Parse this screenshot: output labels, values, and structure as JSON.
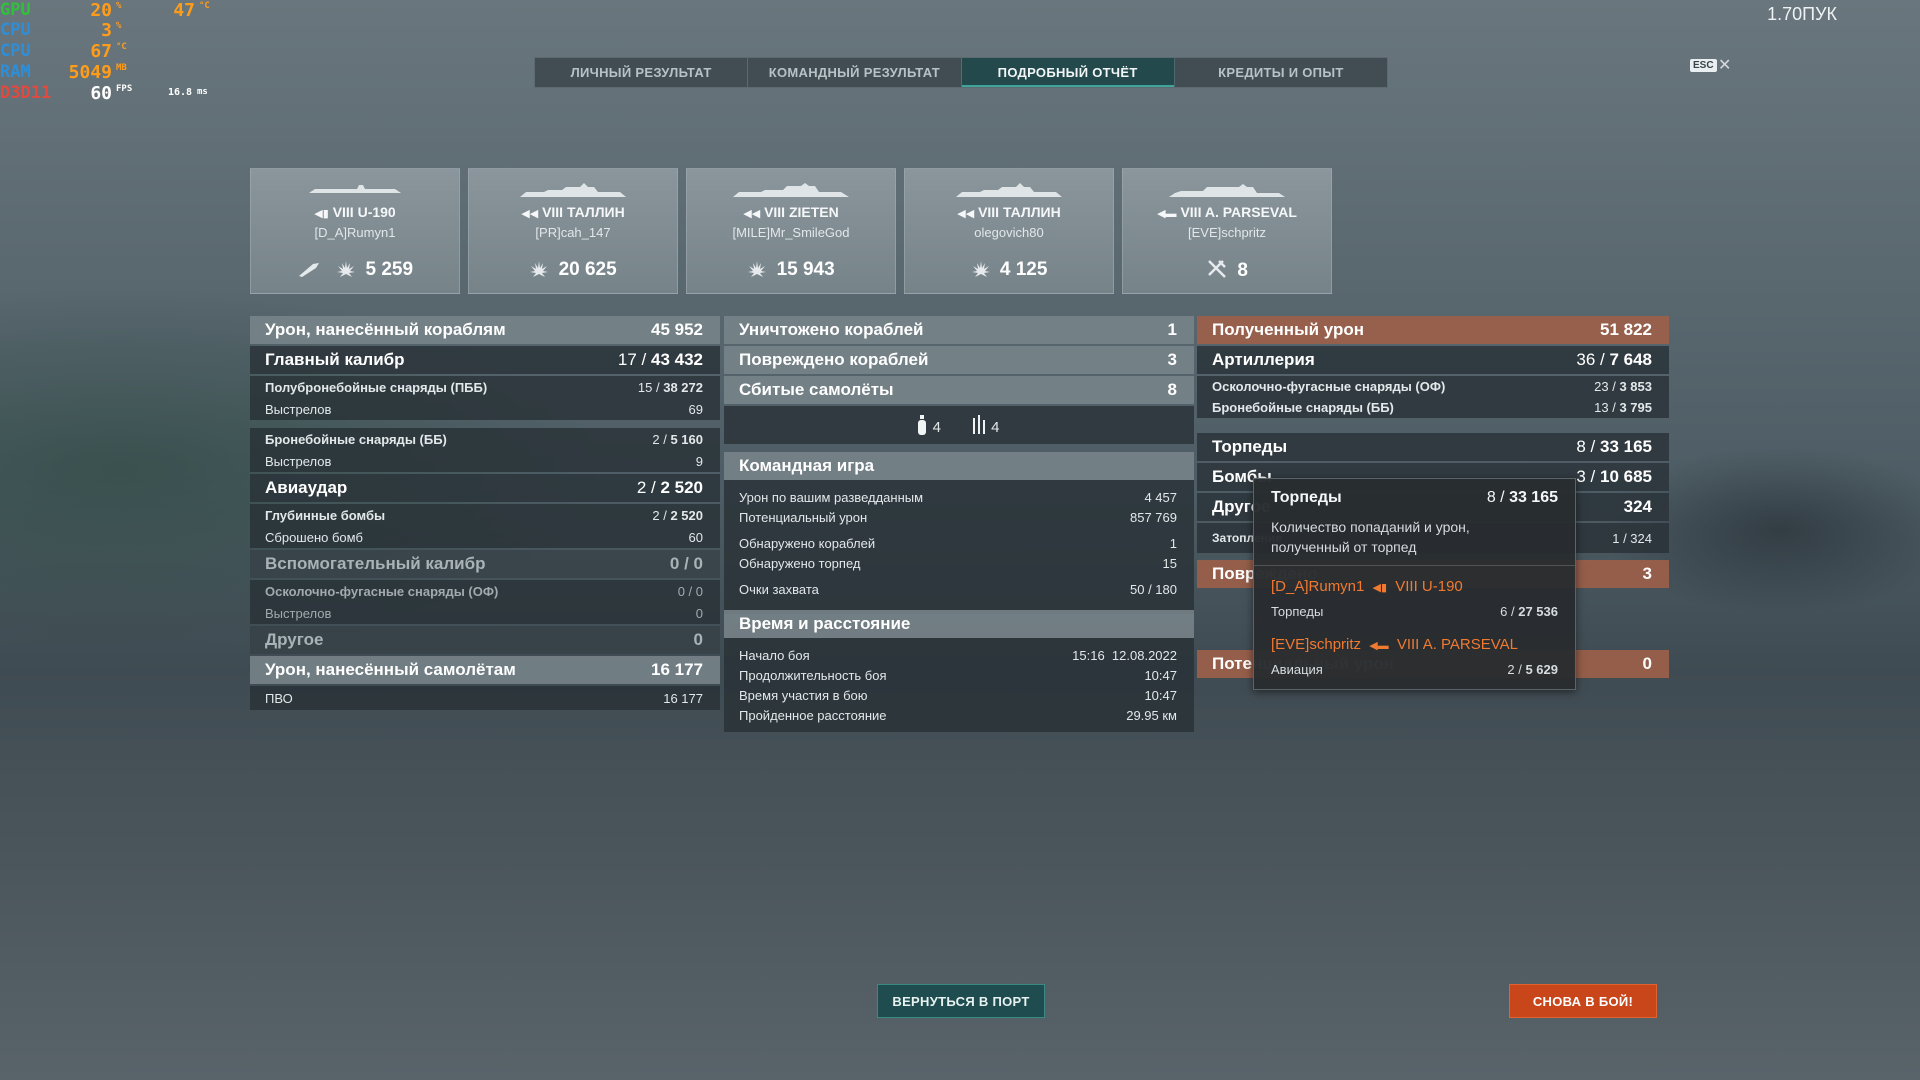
{
  "overlay": {
    "rows": [
      {
        "label": "GPU",
        "label_color": "#2fc13a",
        "value1": "20",
        "unit1": "%",
        "value2": "47",
        "unit2": "°C"
      },
      {
        "label": "CPU",
        "label_color": "#2f8ed8",
        "value1": "3",
        "unit1": "%",
        "value2": "",
        "unit2": ""
      },
      {
        "label": "CPU",
        "label_color": "#2f8ed8",
        "value1": "67",
        "unit1": "°C",
        "value2": "",
        "unit2": ""
      },
      {
        "label": "RAM",
        "label_color": "#2f8ed8",
        "value1": "5049",
        "unit1": "MB",
        "value2": "",
        "unit2": ""
      },
      {
        "label": "D3D11",
        "label_color": "#e2493f",
        "value1": "60",
        "unit1": "FPS",
        "value2": "16.8",
        "unit2": "ms"
      }
    ]
  },
  "top_right_label": "1.70ПУК",
  "esc_label": "ESC",
  "tabs": [
    {
      "label": "ЛИЧНЫЙ РЕЗУЛЬТАТ",
      "active": false
    },
    {
      "label": "КОМАНДНЫЙ РЕЗУЛЬТАТ",
      "active": false
    },
    {
      "label": "ПОДРОБНЫЙ ОТЧЁТ",
      "active": true
    },
    {
      "label": "КРЕДИТЫ И ОПЫТ",
      "active": false
    }
  ],
  "cards": [
    {
      "ship": "VIII U-190",
      "player": "[D_A]Rumyn1",
      "stat": "5 259",
      "icon": "submarine-icon"
    },
    {
      "ship": "VIII ТАЛЛИН",
      "player": "[PR]cah_147",
      "stat": "20 625",
      "icon": "cruiser-icon"
    },
    {
      "ship": "VIII ZIETEN",
      "player": "[MILE]Mr_SmileGod",
      "stat": "15 943",
      "icon": "cruiser-icon"
    },
    {
      "ship": "VIII ТАЛЛИН",
      "player": "olegovich80",
      "stat": "4 125",
      "icon": "cruiser-icon"
    },
    {
      "ship": "VIII A. PARSEVAL",
      "player": "[EVE]schpritz",
      "stat": "8",
      "icon": "carrier-icon"
    }
  ],
  "left": {
    "dmg_ships": {
      "label": "Урон, нанесённый кораблям",
      "value": "45 952"
    },
    "main_battery": {
      "label": "Главный калибр",
      "hits": "17",
      "dmg": "43 432"
    },
    "sap": {
      "label": "Полубронебойные снаряды (ПББ)",
      "hits": "15",
      "dmg": "38 272"
    },
    "sap_shots": {
      "label": "Выстрелов",
      "value": "69"
    },
    "ap": {
      "label": "Бронебойные снаряды (ББ)",
      "hits": "2",
      "dmg": "5 160"
    },
    "ap_shots": {
      "label": "Выстрелов",
      "value": "9"
    },
    "air": {
      "label": "Авиаудар",
      "hits": "2",
      "dmg": "2 520"
    },
    "depth": {
      "label": "Глубинные бомбы",
      "hits": "2",
      "dmg": "2 520"
    },
    "bombs_dropped": {
      "label": "Сброшено бомб",
      "value": "60"
    },
    "secondary": {
      "label": "Вспомогательный калибр",
      "hits": "0",
      "dmg": "0"
    },
    "he": {
      "label": "Осколочно-фугасные снаряды (ОФ)",
      "hits": "0",
      "dmg": "0"
    },
    "he_shots": {
      "label": "Выстрелов",
      "value": "0"
    },
    "other": {
      "label": "Другое",
      "value": "0"
    },
    "dmg_planes": {
      "label": "Урон, нанесённый самолётам",
      "value": "16 177"
    },
    "aa": {
      "label": "ПВО",
      "value": "16 177"
    }
  },
  "middle": {
    "destroyed": {
      "label": "Уничтожено кораблей",
      "value": "1"
    },
    "damaged": {
      "label": "Повреждено кораблей",
      "value": "3"
    },
    "planes": {
      "label": "Сбитые самолёты",
      "value": "8"
    },
    "planes_icons": [
      {
        "icon": "bomber-icon",
        "value": "4"
      },
      {
        "icon": "fighter-icon",
        "value": "4"
      }
    ],
    "team_header": "Командная игра",
    "spotting_dmg": {
      "label": "Урон по вашим разведданным",
      "value": "4 457"
    },
    "potential_dmg": {
      "label": "Потенциальный урон",
      "value": "857 769"
    },
    "ships_spotted": {
      "label": "Обнаружено кораблей",
      "value": "1"
    },
    "torps_spotted": {
      "label": "Обнаружено торпед",
      "value": "15"
    },
    "capture": {
      "label": "Очки захвата",
      "value": "50 / 180"
    },
    "time_header": "Время и расстояние",
    "start": {
      "label": "Начало боя",
      "value": "15:16  12.08.2022"
    },
    "duration": {
      "label": "Продолжительность боя",
      "value": "10:47"
    },
    "participation": {
      "label": "Время участия в бою",
      "value": "10:47"
    },
    "distance": {
      "label": "Пройденное расстояние",
      "value": "29.95 км"
    }
  },
  "right": {
    "received": {
      "label": "Полученный урон",
      "value": "51 822"
    },
    "artillery": {
      "label": "Артиллерия",
      "hits": "36",
      "dmg": "7 648"
    },
    "he": {
      "label": "Осколочно-фугасные снаряды (ОФ)",
      "hits": "23",
      "dmg": "3 853"
    },
    "ap": {
      "label": "Бронебойные снаряды (ББ)",
      "hits": "13",
      "dmg": "3 795"
    },
    "torps": {
      "label": "Торпеды",
      "hits": "8",
      "dmg": "33 165"
    },
    "bombs": {
      "label": "Бомбы",
      "hits": "3",
      "dmg": "10 685"
    },
    "other": {
      "label": "Другое",
      "value": "324"
    },
    "flooding": {
      "label": "Затопление",
      "hits": "1",
      "dmg": "324"
    },
    "damaged_row": {
      "label": "Повреждено",
      "value": "3"
    },
    "potential_row": {
      "label": "Потенциальный урон",
      "value": "0"
    }
  },
  "tooltip": {
    "title": "Торпеды",
    "hits": "8",
    "dmg": "33 165",
    "desc": "Количество попаданий и урон, полученный от торпед",
    "entries": [
      {
        "player": "[D_A]Rumyn1",
        "ship": "VIII U-190",
        "kind": "Торпеды",
        "hits": "6",
        "dmg": "27 536"
      },
      {
        "player": "[EVE]schpritz",
        "ship": "VIII A. PARSEVAL",
        "kind": "Авиация",
        "hits": "2",
        "dmg": "5 629"
      }
    ]
  },
  "buttons": {
    "port": "ВЕРНУТЬСЯ В ПОРТ",
    "battle": "СНОВА В БОЙ!"
  }
}
